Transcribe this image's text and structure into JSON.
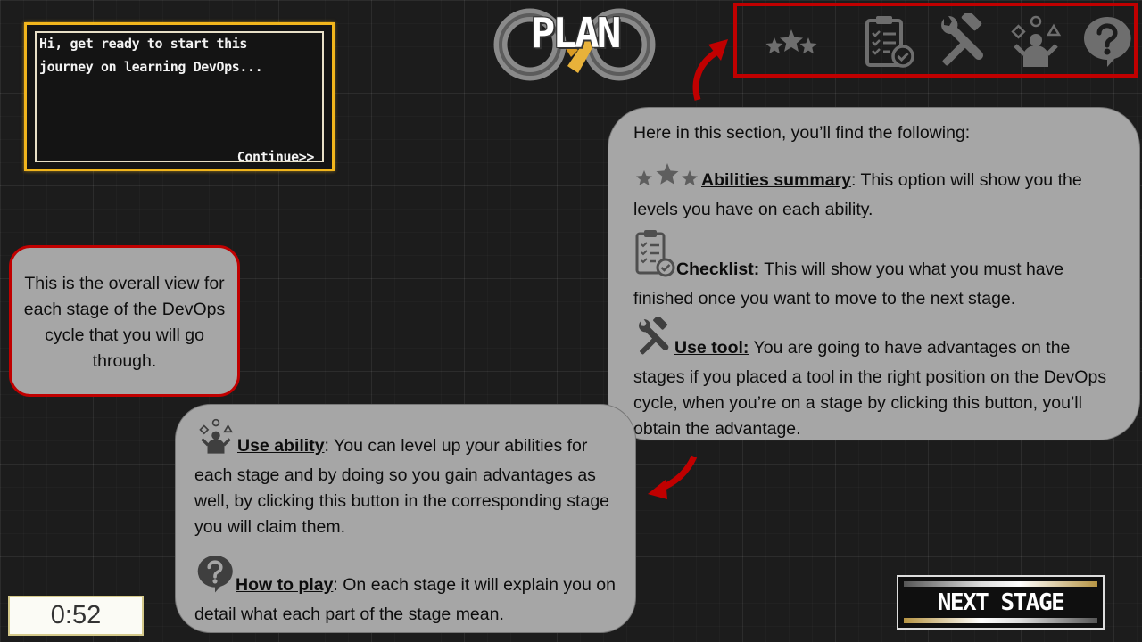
{
  "dialog": {
    "text": "Hi, get ready to start this journey on learning DevOps...",
    "continue_label": "Continue>>"
  },
  "stage": {
    "title": "PLAN"
  },
  "toolbar": {
    "items": [
      {
        "name": "abilities-summary",
        "icon": "three-stars-icon"
      },
      {
        "name": "checklist",
        "icon": "clipboard-checklist-icon"
      },
      {
        "name": "use-tool",
        "icon": "wrench-hammer-icon"
      },
      {
        "name": "use-ability",
        "icon": "person-shapes-icon"
      },
      {
        "name": "how-to-play",
        "icon": "question-bubble-icon"
      }
    ]
  },
  "overview_callout": {
    "text": "This is the overall view for each stage of the DevOps cycle that you will go through."
  },
  "info_callout": {
    "intro": "Here in this section, you’ll find the following:",
    "abilities": {
      "head": "Abilities summary",
      "text": ": This option will show you the levels you have on each ability."
    },
    "checklist": {
      "head": "Checklist:",
      "text": " This will show you what you must have finished once you want to move to the next stage."
    },
    "tool": {
      "head": "Use tool:",
      "text": " You are going to have advantages on the stages if you placed a tool in the right position on the DevOps cycle, when you’re on a stage by clicking this button, you’ll obtain the advantage."
    }
  },
  "ability_callout": {
    "ability": {
      "head": "Use ability",
      "text": ": You can level up your abilities for each stage and by doing so you gain advantages as well, by clicking this button in the corresponding stage you will claim them."
    },
    "howto": {
      "head": "How to play",
      "text": ": On each stage it will explain you on detail what each part of the stage mean."
    }
  },
  "timer": {
    "value": "0:52"
  },
  "next_stage": {
    "label": "NEXT STAGE"
  },
  "colors": {
    "highlight": "#c00000",
    "dialog_border": "#f1b51c",
    "callout_bg": "#a6a6a6",
    "icon": "#6e6e6e"
  }
}
